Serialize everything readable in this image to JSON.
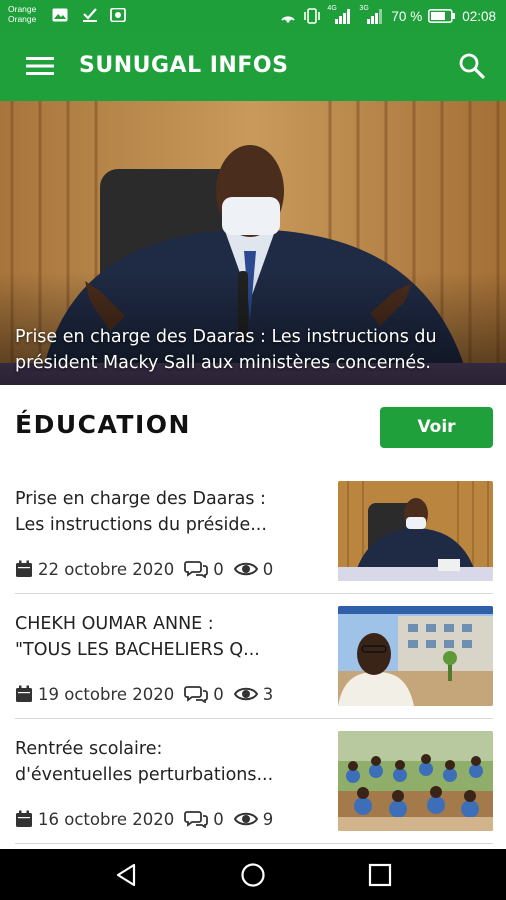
{
  "status_bar": {
    "carrier_line1": "Orange",
    "carrier_line2": "Orange",
    "network_tag1": "4G",
    "network_tag2": "3G",
    "battery": "70 %",
    "time": "02:08"
  },
  "app_bar": {
    "title": "SUNUGAL INFOS",
    "menu_icon": "menu-icon",
    "search_icon": "search-icon"
  },
  "hero": {
    "caption_line1": "Prise en charge des Daaras : Les instructions du",
    "caption_line2": "président Macky Sall aux ministères concernés."
  },
  "section": {
    "title": "ÉDUCATION",
    "button_label": "Voir"
  },
  "articles": [
    {
      "title_line1": "Prise en charge des Daaras :",
      "title_line2": "Les instructions du préside...",
      "date": "22 octobre 2020",
      "comments": "0",
      "views": "0"
    },
    {
      "title_line1": "CHEKH OUMAR ANNE :",
      "title_line2": "\"TOUS LES BACHELIERS Q...",
      "date": "19 octobre 2020",
      "comments": "0",
      "views": "3"
    },
    {
      "title_line1": "Rentrée scolaire:",
      "title_line2": "d'éventuelles perturbations...",
      "date": "16 octobre 2020",
      "comments": "0",
      "views": "9"
    }
  ],
  "colors": {
    "primary_green": "#1fa03b",
    "status_green": "#1e9f3a",
    "nav_bar": "#000000"
  }
}
